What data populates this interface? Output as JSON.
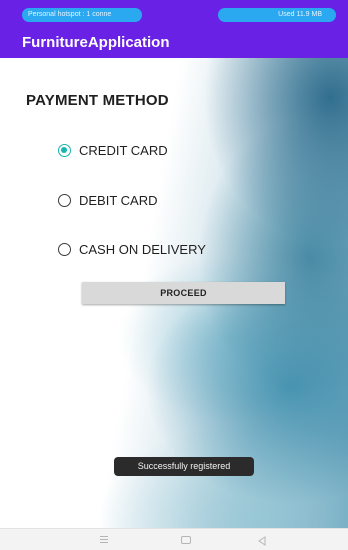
{
  "status_bar": {
    "hotspot_text": "Personal hotspot : 1 conne",
    "data_used_text": "Used 11.9 MB"
  },
  "app_bar": {
    "title": "FurnitureApplication"
  },
  "content": {
    "heading": "PAYMENT METHOD",
    "options": [
      {
        "label": "CREDIT CARD",
        "selected": true
      },
      {
        "label": "DEBIT CARD",
        "selected": false
      },
      {
        "label": "CASH ON DELIVERY",
        "selected": false
      }
    ],
    "proceed_label": "PROCEED",
    "toast_text": "Successfully registered"
  },
  "colors": {
    "primary": "#6a21e6",
    "pill": "#2ba9f0",
    "radio_checked": "#19b5b0"
  },
  "nav_bar": {
    "icons": [
      "menu-icon",
      "home-icon",
      "back-icon"
    ]
  }
}
